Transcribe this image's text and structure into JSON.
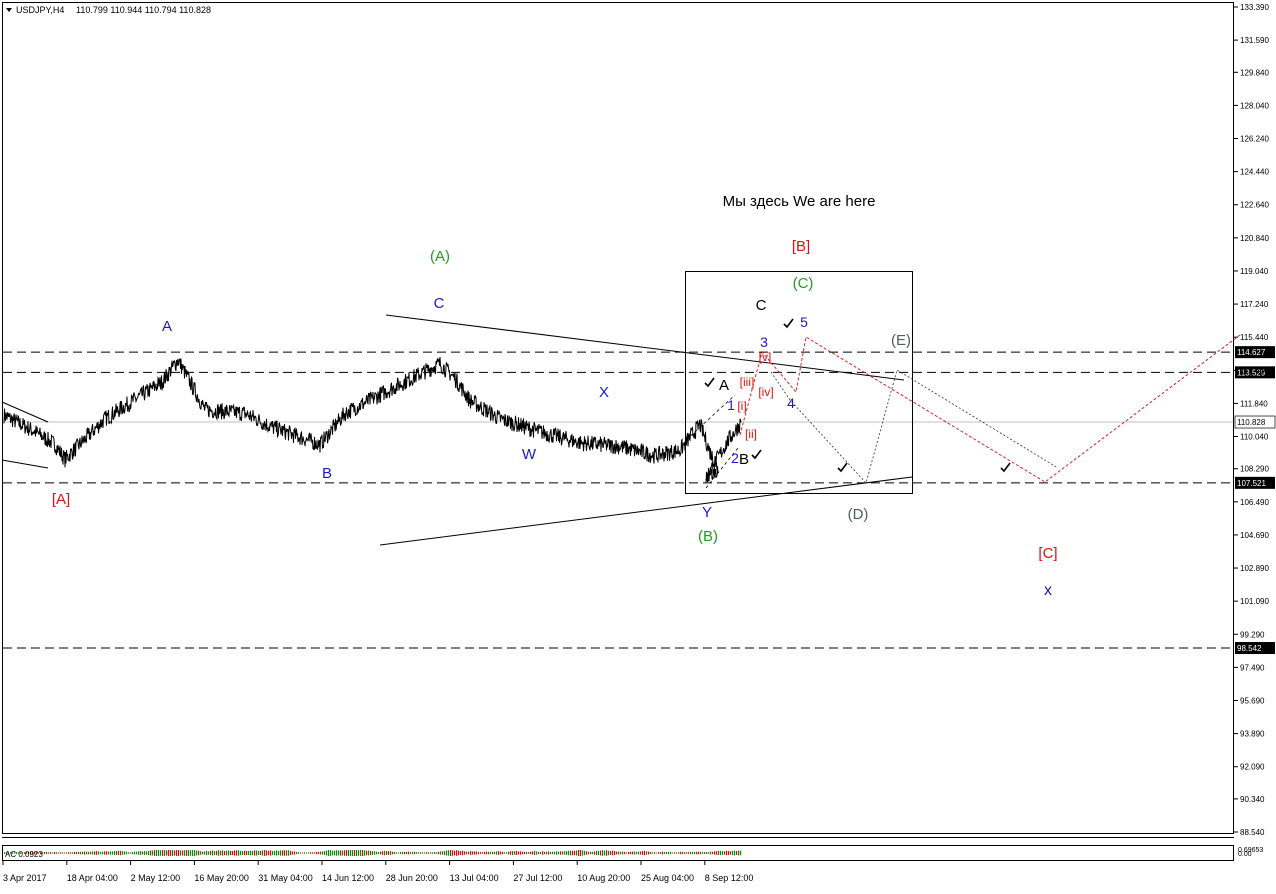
{
  "header": {
    "symbol": "USDJPY,H4",
    "ohlc": "110.799 110.944 110.794 110.828"
  },
  "indicator": {
    "label": "AC 0.0923"
  },
  "colors": {
    "bg": "#ffffff",
    "grid": "#000000",
    "price": "#000000",
    "black": "#000000",
    "blue": "#1a1acc",
    "green": "#1f9e1f",
    "red": "#dd1111",
    "gray": "#4f5f5f",
    "hist_up": "#0a8a0a",
    "hist_down": "#cc1111"
  },
  "axis": {
    "price_ticks": [
      "133.390",
      "131.590",
      "129.840",
      "128.040",
      "126.240",
      "124.440",
      "122.640",
      "120.840",
      "119.040",
      "117.240",
      "115.440",
      "113.640",
      "111.840",
      "110.040",
      "108.290",
      "106.490",
      "104.690",
      "102.890",
      "101.090",
      "99.290",
      "97.490",
      "95.690",
      "93.890",
      "92.090",
      "90.340",
      "88.540"
    ],
    "time_ticks": [
      "3 Apr 2017",
      "18 Apr 04:00",
      "2 May 12:00",
      "16 May 20:00",
      "31 May 04:00",
      "14 Jun 12:00",
      "28 Jun 20:00",
      "13 Jul 04:00",
      "27 Jul 12:00",
      "10 Aug 20:00",
      "25 Aug 04:00",
      "8 Sep 12:00"
    ],
    "indicator_ticks": [
      "0.69653",
      "0.00"
    ]
  },
  "chart_data": {
    "type": "line",
    "title": "USDJPY,H4",
    "ylim": [
      88.54,
      133.39
    ],
    "price_levels": [
      {
        "value": 114.627,
        "label": "114.627"
      },
      {
        "value": 113.529,
        "label": "113.529"
      },
      {
        "value": 107.521,
        "label": "107.521"
      },
      {
        "value": 98.542,
        "label": "98.542"
      }
    ],
    "current_price": {
      "value": 110.828,
      "label": "110.828"
    },
    "series": [
      {
        "values_x": [
          "3 Apr 2017",
          "10 Apr",
          "13 Apr",
          "17 Apr",
          "24 Apr",
          "2 May",
          "10 May",
          "16 May",
          "24 May",
          "31 May",
          "7 Jun",
          "14 Jun",
          "21 Jun",
          "28 Jun",
          "4 Jul",
          "11 Jul",
          "17 Jul",
          "27 Jul",
          "3 Aug",
          "10 Aug",
          "17 Aug",
          "22 Aug",
          "25 Aug",
          "1 Sep",
          "4 Sep",
          "6 Sep",
          "8 Sep",
          "11 Sep",
          "13 Sep"
        ],
        "values": [
          111.2,
          110.3,
          109.6,
          108.8,
          111.0,
          113.0,
          114.2,
          111.5,
          111.3,
          110.6,
          110.0,
          109.6,
          111.3,
          112.6,
          114.0,
          113.2,
          112.0,
          111.0,
          110.3,
          109.7,
          109.5,
          109.0,
          109.3,
          110.7,
          109.2,
          108.3,
          107.8,
          109.8,
          110.8
        ]
      }
    ],
    "annotations": {
      "text": "Мы здесь We are here",
      "labels": [
        "(A)",
        "A",
        "C",
        "B",
        "[A]",
        "W",
        "X",
        "Y",
        "(B)",
        "A",
        "B",
        "C",
        "1",
        "2",
        "3",
        "4",
        "5",
        "[i]",
        "[ii]",
        "[iii]",
        "[iv]",
        "[v]",
        "(C)",
        "[B]",
        "(D)",
        "(E)",
        "[C]",
        "x"
      ]
    }
  }
}
